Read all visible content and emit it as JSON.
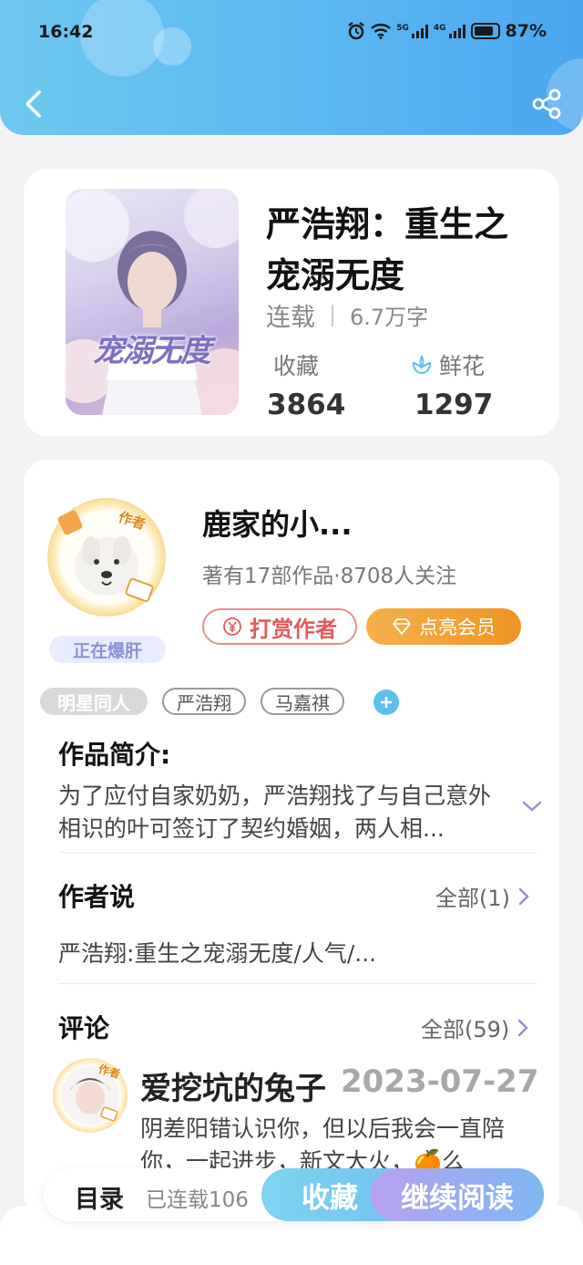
{
  "status": {
    "time": "16:42",
    "net1": "5G",
    "net2": "4G",
    "battery": "87%",
    "battery_level": 0.87
  },
  "book": {
    "title": "严浩翔：重生之宠溺无度",
    "status": "连载",
    "words": "6.7万字",
    "collect_label": "收藏",
    "collect_count": "3864",
    "flower_label": "鲜花",
    "flower_count": "1297",
    "cover_text": "宠溺无度"
  },
  "author": {
    "badge": "作者",
    "name": "鹿家的小...",
    "info": "著有17部作品·8708人关注",
    "status_badge": "正在爆肝",
    "tip_label": "打赏作者",
    "vip_label": "点亮会员"
  },
  "tags": [
    "明星同人",
    "严浩翔",
    "马嘉祺"
  ],
  "intro": {
    "title": "作品简介:",
    "text": "为了应付自家奶奶，严浩翔找了与自己意外相识的叶可签订了契约婚姻，两人相..."
  },
  "author_say": {
    "title": "作者说",
    "link": "全部(1)",
    "text": "严浩翔:重生之宠溺无度/人气/..."
  },
  "comments": {
    "title": "评论",
    "link": "全部(59)",
    "items": [
      {
        "badge": "作者",
        "user": "爱挖坑的兔子",
        "date": "2023-07-27",
        "text": "阴差阳错认识你，但以后我会一直陪你，一起进步，新文大火，🍊么"
      }
    ]
  },
  "bottom": {
    "catalog_label": "目录",
    "serial_label": "已连载106",
    "collect_button": "收藏",
    "continue_button": "继续阅读"
  },
  "colors": {
    "header_blue": "#5bb8f0",
    "tip_red": "#e45a5a",
    "vip_orange": "#ef9326",
    "tag_gray": "#d9d9d9",
    "plus_blue": "#5cc0ec"
  }
}
